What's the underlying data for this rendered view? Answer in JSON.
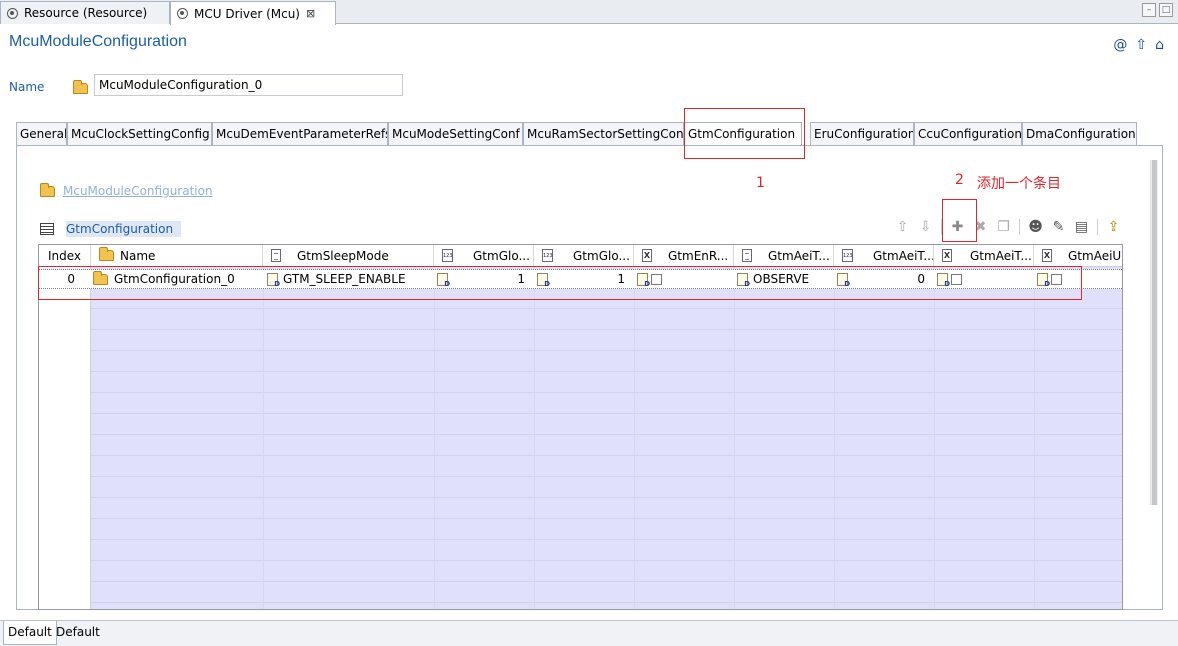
{
  "editor_tabs": [
    {
      "label": "Resource (Resource)",
      "active": false
    },
    {
      "label": "MCU Driver (Mcu)",
      "active": true,
      "close": "⊠"
    }
  ],
  "window_buttons": [
    "–",
    "□"
  ],
  "header": {
    "title": "McuModuleConfiguration",
    "icons": [
      "at-icon",
      "up-arrow-icon",
      "home-icon"
    ]
  },
  "name_field": {
    "label": "Name",
    "value": "McuModuleConfiguration_0"
  },
  "config_tabs": [
    "General",
    "McuClockSettingConfig",
    "McuDemEventParameterRefs",
    "McuModeSettingConf",
    "McuRamSectorSettingConf",
    "GtmConfiguration",
    "EruConfiguration",
    "CcuConfiguration",
    "DmaConfiguration"
  ],
  "active_tab": "GtmConfiguration",
  "breadcrumb": "McuModuleConfiguration",
  "table_title": "GtmConfiguration",
  "toolbar": [
    "move-up-icon",
    "move-down-icon",
    "add-icon",
    "delete-icon",
    "copy-icon",
    "user-icon",
    "edit-icon",
    "edit-form-icon",
    "export-icon"
  ],
  "grid": {
    "columns": [
      "Index",
      "Name",
      "GtmSleepMode",
      "GtmGlo...",
      "GtmGlo...",
      "GtmEnR...",
      "GtmAeiT...",
      "GtmAeiT...",
      "GtmAeiT...",
      "GtmAeiU..."
    ],
    "rows": [
      {
        "index": "0",
        "name": "GtmConfiguration_0",
        "sleep_mode": "GTM_SLEEP_ENABLE",
        "glo1": "1",
        "glo2": "1",
        "en_r": false,
        "aei_t1": "OBSERVE",
        "aei_t2": "0",
        "aei_t3": false,
        "aei_u": false
      }
    ]
  },
  "annotations": {
    "step1": "1",
    "step2": "2",
    "step2_text": "添加一个条目"
  },
  "bottom_tabs": [
    "Default",
    "Default"
  ]
}
